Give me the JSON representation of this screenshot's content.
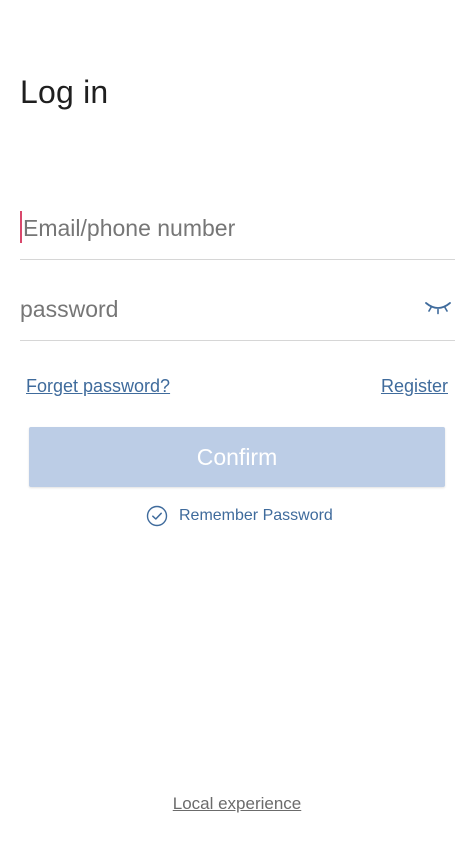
{
  "header": {
    "title": "Log in"
  },
  "form": {
    "email_placeholder": "Email/phone number",
    "password_placeholder": "password",
    "password_toggle_icon": "eye-closed-icon",
    "forget_password": "Forget password?",
    "register": "Register",
    "confirm_label": "Confirm",
    "remember_label": "Remember Password",
    "remember_icon": "check-circle-icon"
  },
  "footer": {
    "local_experience": "Local experience"
  },
  "colors": {
    "link": "#3f6b9c",
    "button_disabled": "#bccde6",
    "caret": "#d9486c",
    "divider": "#d6d6d6"
  }
}
